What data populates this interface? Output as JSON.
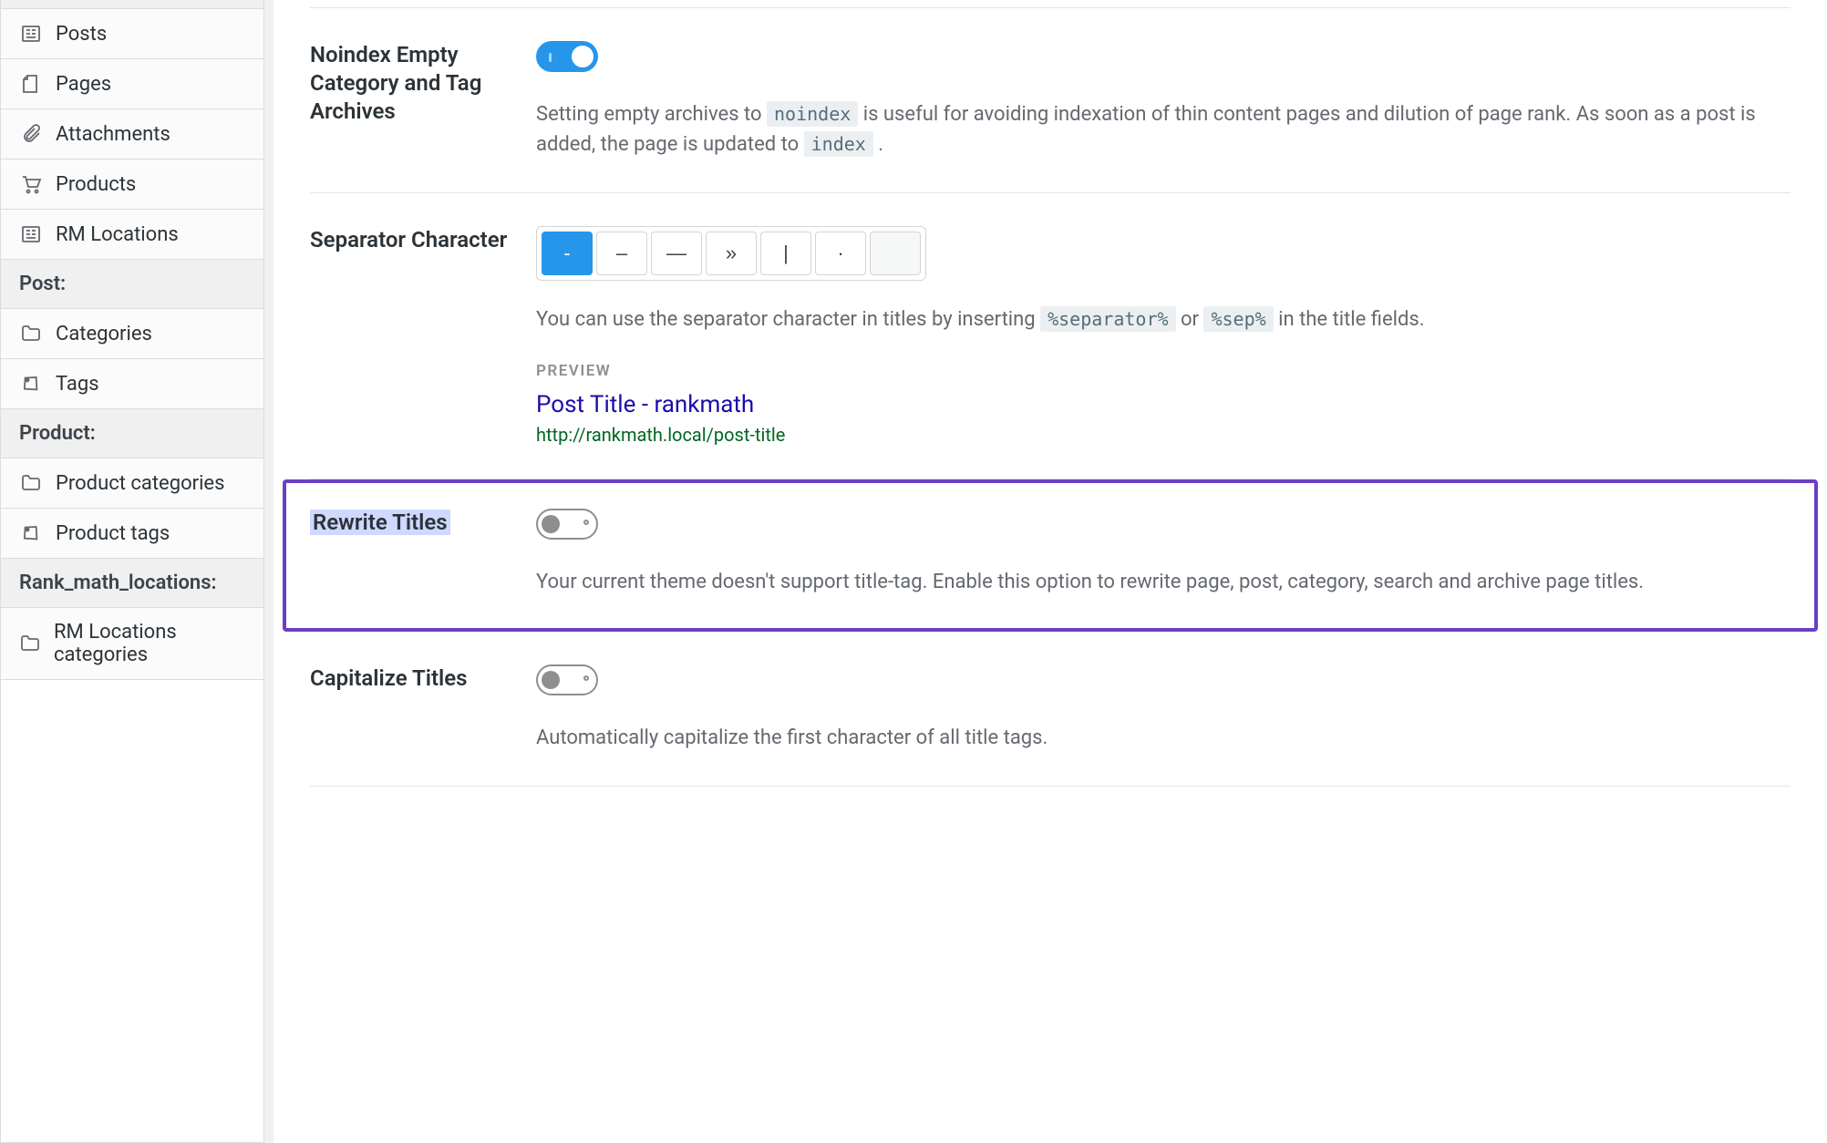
{
  "sidebar": {
    "items": [
      {
        "label": "Posts",
        "icon": "posts"
      },
      {
        "label": "Pages",
        "icon": "pages"
      },
      {
        "label": "Attachments",
        "icon": "attachments"
      },
      {
        "label": "Products",
        "icon": "products"
      },
      {
        "label": "RM Locations",
        "icon": "posts"
      }
    ],
    "sections": [
      {
        "heading": "Post:",
        "items": [
          {
            "label": "Categories",
            "icon": "folder"
          },
          {
            "label": "Tags",
            "icon": "tag"
          }
        ]
      },
      {
        "heading": "Product:",
        "items": [
          {
            "label": "Product categories",
            "icon": "folder"
          },
          {
            "label": "Product tags",
            "icon": "tag"
          }
        ]
      },
      {
        "heading": "Rank_math_locations:",
        "items": [
          {
            "label": "RM Locations categories",
            "icon": "folder"
          }
        ]
      }
    ]
  },
  "settings": {
    "noindex": {
      "label": "Noindex Empty Category and Tag Archives",
      "toggle": "on",
      "desc_pre": "Setting empty archives to ",
      "desc_code1": "noindex",
      "desc_mid": " is useful for avoiding indexation of thin content pages and dilution of page rank. As soon as a post is added, the page is updated to ",
      "desc_code2": "index",
      "desc_post": " ."
    },
    "separator": {
      "label": "Separator Character",
      "options": [
        "-",
        "–",
        "—",
        "»",
        "|",
        "·",
        ""
      ],
      "active_index": 0,
      "desc_pre": "You can use the separator character in titles by inserting ",
      "desc_code1": "%separator%",
      "desc_mid": " or ",
      "desc_code2": "%sep%",
      "desc_post": " in the title fields.",
      "preview_label": "PREVIEW",
      "preview_title": "Post Title - rankmath",
      "preview_url": "http://rankmath.local/post-title"
    },
    "rewrite": {
      "label": "Rewrite Titles",
      "toggle": "off",
      "desc": "Your current theme doesn't support title-tag. Enable this option to rewrite page, post, category, search and archive page titles."
    },
    "capitalize": {
      "label": "Capitalize Titles",
      "toggle": "off",
      "desc": "Automatically capitalize the first character of all title tags."
    }
  }
}
